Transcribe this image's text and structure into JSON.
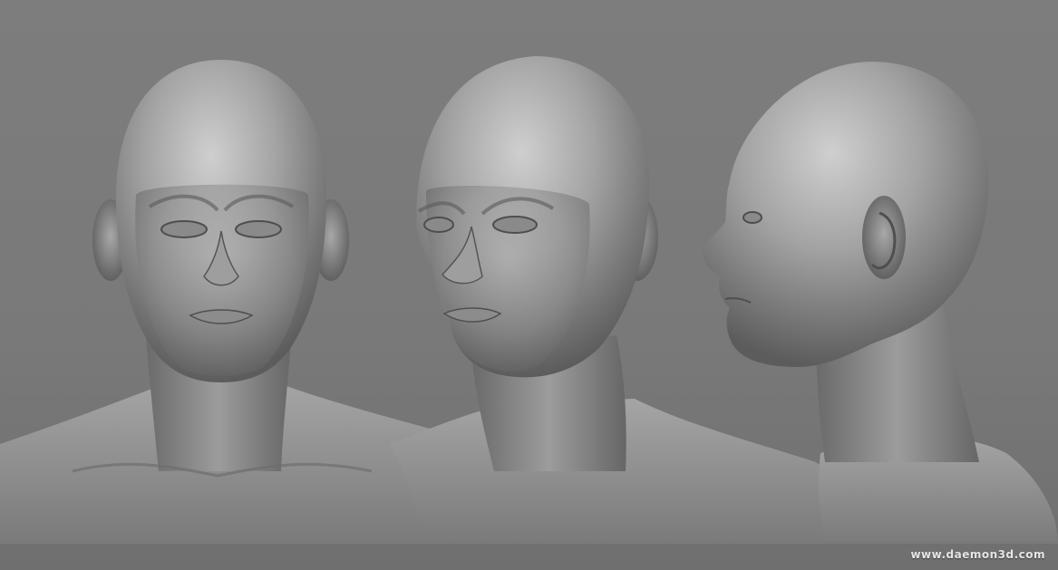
{
  "scene": {
    "background_color": "#7a7a7a",
    "sculpt_color": "#9a9a9a",
    "views": [
      "front-view",
      "three-quarter-view",
      "side-profile-view"
    ]
  },
  "watermark": {
    "text": "www.daemon3d.com"
  }
}
